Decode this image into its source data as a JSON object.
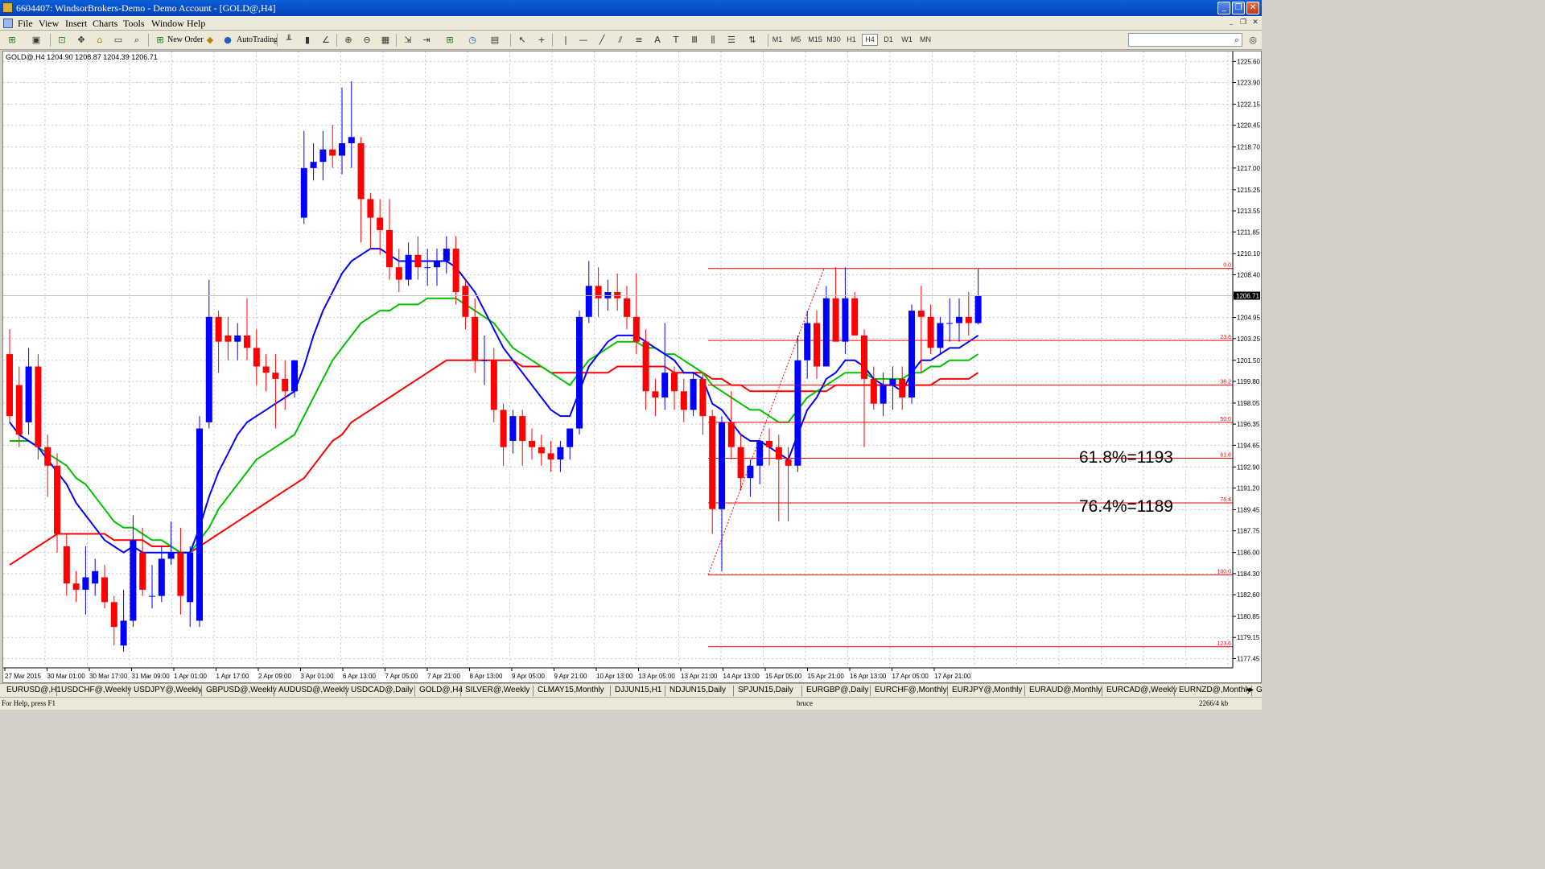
{
  "window": {
    "title": "6604407: WindsorBrokers-Demo - Demo Account - [GOLD@,H4]"
  },
  "menu": [
    "File",
    "View",
    "Insert",
    "Charts",
    "Tools",
    "Window",
    "Help"
  ],
  "toolbar": {
    "new_order": "New Order",
    "autotrading": "AutoTrading",
    "timeframes": [
      "M1",
      "M5",
      "M15",
      "M30",
      "H1",
      "H4",
      "D1",
      "W1",
      "MN"
    ],
    "active_timeframe": "H4"
  },
  "chart_data": {
    "type": "candlestick",
    "symbol_header": "GOLD@,H4  1204.90 1208.87 1204.39 1206.71",
    "current_price": 1206.71,
    "ylim": [
      1176.7,
      1226.4
    ],
    "y_ticks": [
      "1225.60",
      "1223.90",
      "1222.15",
      "1220.45",
      "1218.70",
      "1217.00",
      "1215.25",
      "1213.55",
      "1211.85",
      "1210.10",
      "1208.40",
      "1206.71",
      "1204.95",
      "1203.25",
      "1201.50",
      "1199.80",
      "1198.05",
      "1196.35",
      "1194.65",
      "1192.90",
      "1191.20",
      "1189.45",
      "1187.75",
      "1186.00",
      "1184.30",
      "1182.60",
      "1180.85",
      "1179.15",
      "1177.45"
    ],
    "x_labels": [
      "27 Mar 2015",
      "30 Mar 01:00",
      "30 Mar 17:00",
      "31 Mar 09:00",
      "1 Apr 01:00",
      "1 Apr 17:00",
      "2 Apr 09:00",
      "3 Apr 01:00",
      "6 Apr 13:00",
      "7 Apr 05:00",
      "7 Apr 21:00",
      "8 Apr 13:00",
      "9 Apr 05:00",
      "9 Apr 21:00",
      "10 Apr 13:00",
      "13 Apr 05:00",
      "13 Apr 21:00",
      "14 Apr 13:00",
      "15 Apr 05:00",
      "15 Apr 21:00",
      "16 Apr 13:00",
      "17 Apr 05:00",
      "17 Apr 21:00"
    ],
    "colors": {
      "bull": "#0000ff",
      "bear": "#ff0000",
      "ma_fast": "#0000ff",
      "ma_mid": "#00c000",
      "ma_slow": "#ff0000",
      "fib": "#ff0000"
    },
    "candles": [
      [
        1202.0,
        1204.0,
        1196.5,
        1197.0
      ],
      [
        1199.5,
        1201.0,
        1194.5,
        1195.5
      ],
      [
        1196.5,
        1202.5,
        1195.5,
        1201.0
      ],
      [
        1201.0,
        1202.0,
        1193.5,
        1194.5
      ],
      [
        1194.5,
        1195.5,
        1190.5,
        1193.0
      ],
      [
        1193.0,
        1194.0,
        1186.0,
        1187.5
      ],
      [
        1186.5,
        1187.5,
        1182.5,
        1183.5
      ],
      [
        1183.5,
        1184.5,
        1182.0,
        1183.0
      ],
      [
        1183.0,
        1186.5,
        1181.0,
        1184.0
      ],
      [
        1183.5,
        1185.5,
        1182.5,
        1184.5
      ],
      [
        1184.0,
        1185.0,
        1181.5,
        1182.0
      ],
      [
        1182.0,
        1182.5,
        1178.5,
        1180.0
      ],
      [
        1178.5,
        1183.0,
        1178.0,
        1180.5
      ],
      [
        1180.5,
        1189.0,
        1180.0,
        1187.0
      ],
      [
        1186.0,
        1188.0,
        1182.5,
        1183.0
      ],
      [
        1182.5,
        1185.0,
        1181.5,
        1182.5
      ],
      [
        1182.5,
        1186.5,
        1182.0,
        1185.5
      ],
      [
        1185.5,
        1188.5,
        1185.0,
        1186.0
      ],
      [
        1186.0,
        1188.0,
        1181.0,
        1182.5
      ],
      [
        1182.0,
        1186.5,
        1180.0,
        1186.0
      ],
      [
        1180.5,
        1197.0,
        1180.0,
        1196.0
      ],
      [
        1196.5,
        1208.0,
        1196.0,
        1205.0
      ],
      [
        1205.0,
        1205.5,
        1200.5,
        1203.0
      ],
      [
        1203.5,
        1205.0,
        1201.5,
        1203.0
      ],
      [
        1203.0,
        1204.5,
        1201.5,
        1203.5
      ],
      [
        1203.5,
        1206.5,
        1201.5,
        1202.5
      ],
      [
        1202.5,
        1204.0,
        1199.5,
        1201.0
      ],
      [
        1201.0,
        1202.0,
        1199.0,
        1200.5
      ],
      [
        1200.5,
        1202.0,
        1196.0,
        1200.0
      ],
      [
        1200.0,
        1201.5,
        1197.5,
        1199.0
      ],
      [
        1199.0,
        1201.5,
        1198.5,
        1201.5
      ],
      [
        1213.0,
        1220.0,
        1212.5,
        1217.0
      ],
      [
        1217.0,
        1219.0,
        1216.0,
        1217.5
      ],
      [
        1217.5,
        1220.0,
        1216.0,
        1218.5
      ],
      [
        1218.5,
        1220.5,
        1217.0,
        1218.0
      ],
      [
        1218.0,
        1223.5,
        1216.5,
        1219.0
      ],
      [
        1219.0,
        1224.0,
        1217.0,
        1219.5
      ],
      [
        1219.0,
        1219.5,
        1211.0,
        1214.5
      ],
      [
        1214.5,
        1215.0,
        1210.5,
        1213.0
      ],
      [
        1213.0,
        1214.5,
        1210.0,
        1212.0
      ],
      [
        1212.0,
        1214.5,
        1208.0,
        1209.0
      ],
      [
        1209.0,
        1210.5,
        1207.0,
        1208.0
      ],
      [
        1208.0,
        1211.0,
        1207.5,
        1210.0
      ],
      [
        1210.0,
        1211.5,
        1208.0,
        1209.0
      ],
      [
        1209.0,
        1210.5,
        1207.5,
        1209.0
      ],
      [
        1209.0,
        1210.5,
        1207.5,
        1209.5
      ],
      [
        1209.5,
        1211.5,
        1208.5,
        1210.5
      ],
      [
        1210.5,
        1211.5,
        1206.0,
        1207.0
      ],
      [
        1207.5,
        1208.0,
        1204.0,
        1205.0
      ],
      [
        1205.0,
        1206.5,
        1200.5,
        1201.5
      ],
      [
        1201.5,
        1203.5,
        1199.5,
        1201.5
      ],
      [
        1201.5,
        1202.5,
        1196.5,
        1197.5
      ],
      [
        1197.5,
        1198.0,
        1193.0,
        1194.5
      ],
      [
        1195.0,
        1197.5,
        1194.0,
        1197.0
      ],
      [
        1197.0,
        1197.5,
        1193.0,
        1195.0
      ],
      [
        1195.0,
        1196.0,
        1193.5,
        1194.5
      ],
      [
        1194.5,
        1195.5,
        1193.0,
        1194.0
      ],
      [
        1194.0,
        1195.0,
        1192.5,
        1193.5
      ],
      [
        1193.5,
        1195.0,
        1192.5,
        1194.5
      ],
      [
        1194.5,
        1196.0,
        1193.5,
        1196.0
      ],
      [
        1196.0,
        1205.5,
        1195.5,
        1205.0
      ],
      [
        1205.0,
        1209.5,
        1204.5,
        1207.5
      ],
      [
        1207.5,
        1209.0,
        1205.0,
        1206.5
      ],
      [
        1206.5,
        1208.0,
        1205.5,
        1207.0
      ],
      [
        1207.0,
        1208.5,
        1205.5,
        1206.5
      ],
      [
        1206.5,
        1207.5,
        1204.0,
        1205.0
      ],
      [
        1205.0,
        1208.5,
        1202.0,
        1203.0
      ],
      [
        1203.0,
        1204.0,
        1197.5,
        1199.0
      ],
      [
        1199.0,
        1200.0,
        1197.0,
        1198.5
      ],
      [
        1198.5,
        1204.5,
        1197.5,
        1200.5
      ],
      [
        1200.5,
        1201.0,
        1197.5,
        1199.0
      ],
      [
        1199.0,
        1200.0,
        1196.5,
        1197.5
      ],
      [
        1197.5,
        1200.5,
        1197.0,
        1200.0
      ],
      [
        1200.0,
        1200.5,
        1195.5,
        1197.0
      ],
      [
        1197.0,
        1197.5,
        1187.5,
        1189.5
      ],
      [
        1189.5,
        1197.0,
        1184.5,
        1196.5
      ],
      [
        1196.5,
        1199.0,
        1193.5,
        1194.5
      ],
      [
        1194.5,
        1195.5,
        1191.0,
        1192.0
      ],
      [
        1192.0,
        1193.5,
        1190.5,
        1193.0
      ],
      [
        1193.0,
        1195.0,
        1191.5,
        1195.0
      ],
      [
        1195.0,
        1196.0,
        1193.0,
        1194.5
      ],
      [
        1194.5,
        1195.5,
        1188.5,
        1193.5
      ],
      [
        1193.5,
        1194.5,
        1188.5,
        1193.0
      ],
      [
        1193.0,
        1203.5,
        1192.5,
        1201.5
      ],
      [
        1201.5,
        1205.5,
        1200.0,
        1204.5
      ],
      [
        1204.5,
        1205.5,
        1200.0,
        1201.0
      ],
      [
        1201.0,
        1207.5,
        1201.0,
        1206.5
      ],
      [
        1206.5,
        1209.0,
        1204.5,
        1203.0
      ],
      [
        1203.0,
        1209.0,
        1202.0,
        1206.5
      ],
      [
        1206.5,
        1207.0,
        1203.5,
        1203.5
      ],
      [
        1203.5,
        1204.0,
        1194.5,
        1200.0
      ],
      [
        1200.0,
        1201.0,
        1197.5,
        1198.0
      ],
      [
        1198.0,
        1200.5,
        1197.0,
        1199.5
      ],
      [
        1199.5,
        1201.0,
        1197.5,
        1200.0
      ],
      [
        1200.0,
        1201.0,
        1197.5,
        1198.5
      ],
      [
        1198.5,
        1206.0,
        1198.0,
        1205.5
      ],
      [
        1205.5,
        1207.5,
        1200.5,
        1205.0
      ],
      [
        1205.0,
        1206.0,
        1202.0,
        1202.5
      ],
      [
        1202.5,
        1205.0,
        1202.0,
        1204.5
      ],
      [
        1204.5,
        1206.5,
        1203.0,
        1204.5
      ],
      [
        1204.5,
        1206.5,
        1203.0,
        1205.0
      ],
      [
        1205.0,
        1207.0,
        1203.5,
        1204.5
      ],
      [
        1204.5,
        1208.87,
        1204.39,
        1206.71
      ]
    ],
    "ma_fast": [
      1196.5,
      1195.5,
      1195.0,
      1194.5,
      1193.5,
      1192.5,
      1191.5,
      1190.0,
      1189.0,
      1188.0,
      1187.0,
      1186.5,
      1186.0,
      1186.5,
      1186.0,
      1186.0,
      1186.0,
      1186.0,
      1186.0,
      1186.0,
      1188.0,
      1190.5,
      1192.5,
      1194.0,
      1195.5,
      1196.5,
      1197.0,
      1197.5,
      1198.0,
      1198.5,
      1199.0,
      1201.0,
      1203.5,
      1205.5,
      1207.0,
      1208.5,
      1209.5,
      1210.0,
      1210.5,
      1210.5,
      1210.0,
      1209.5,
      1209.5,
      1209.5,
      1209.5,
      1209.5,
      1209.5,
      1209.0,
      1208.0,
      1207.0,
      1205.5,
      1204.0,
      1202.5,
      1201.5,
      1200.5,
      1199.5,
      1198.5,
      1197.5,
      1197.0,
      1197.0,
      1199.0,
      1201.0,
      1202.0,
      1203.0,
      1203.5,
      1203.5,
      1203.5,
      1203.0,
      1202.5,
      1202.0,
      1201.5,
      1200.5,
      1200.5,
      1200.0,
      1198.0,
      1197.5,
      1196.5,
      1195.5,
      1195.0,
      1195.0,
      1194.5,
      1194.0,
      1193.5,
      1195.5,
      1197.5,
      1198.5,
      1200.0,
      1200.5,
      1201.5,
      1201.5,
      1201.0,
      1200.0,
      1199.5,
      1199.5,
      1199.0,
      1200.5,
      1201.5,
      1201.5,
      1202.0,
      1202.5,
      1202.5,
      1203.0,
      1203.5
    ],
    "ma_mid": [
      1195.0,
      1195.0,
      1195.0,
      1194.5,
      1194.0,
      1193.5,
      1193.0,
      1192.0,
      1191.5,
      1190.5,
      1189.5,
      1188.5,
      1188.0,
      1188.0,
      1187.5,
      1187.0,
      1187.0,
      1186.5,
      1186.0,
      1186.0,
      1187.0,
      1188.0,
      1189.5,
      1190.5,
      1191.5,
      1192.5,
      1193.5,
      1194.0,
      1194.5,
      1195.0,
      1195.5,
      1197.0,
      1198.5,
      1200.0,
      1201.5,
      1202.5,
      1203.5,
      1204.5,
      1205.0,
      1205.5,
      1205.5,
      1206.0,
      1206.0,
      1206.0,
      1206.5,
      1206.5,
      1206.5,
      1206.5,
      1206.0,
      1205.5,
      1205.0,
      1204.5,
      1203.5,
      1202.5,
      1202.0,
      1201.5,
      1201.0,
      1200.5,
      1200.0,
      1199.5,
      1200.5,
      1201.5,
      1202.0,
      1202.5,
      1203.0,
      1203.0,
      1203.0,
      1202.5,
      1202.5,
      1202.0,
      1202.0,
      1201.5,
      1201.0,
      1200.5,
      1199.5,
      1199.0,
      1198.5,
      1198.0,
      1197.5,
      1197.5,
      1197.0,
      1196.5,
      1196.5,
      1197.5,
      1198.5,
      1199.0,
      1199.5,
      1200.0,
      1200.5,
      1200.5,
      1200.5,
      1200.0,
      1200.0,
      1200.0,
      1200.0,
      1200.5,
      1200.5,
      1201.0,
      1201.0,
      1201.5,
      1201.5,
      1201.5,
      1202.0
    ],
    "ma_slow": [
      1185.0,
      1185.5,
      1186.0,
      1186.5,
      1187.0,
      1187.5,
      1187.5,
      1187.5,
      1187.5,
      1187.5,
      1187.5,
      1187.0,
      1187.0,
      1187.0,
      1187.0,
      1186.5,
      1186.5,
      1186.5,
      1186.0,
      1186.0,
      1186.5,
      1187.0,
      1187.5,
      1188.0,
      1188.5,
      1189.0,
      1189.5,
      1190.0,
      1190.5,
      1191.0,
      1191.5,
      1192.0,
      1193.0,
      1194.0,
      1195.0,
      1195.5,
      1196.5,
      1197.0,
      1197.5,
      1198.0,
      1198.5,
      1199.0,
      1199.5,
      1200.0,
      1200.5,
      1201.0,
      1201.5,
      1201.5,
      1201.5,
      1201.5,
      1201.5,
      1201.5,
      1201.5,
      1201.5,
      1201.0,
      1201.0,
      1201.0,
      1200.5,
      1200.5,
      1200.5,
      1200.5,
      1200.5,
      1200.5,
      1200.5,
      1201.0,
      1201.0,
      1201.0,
      1201.0,
      1201.0,
      1201.0,
      1200.5,
      1200.5,
      1200.5,
      1200.5,
      1200.0,
      1200.0,
      1199.5,
      1199.5,
      1199.0,
      1199.0,
      1199.0,
      1199.0,
      1199.0,
      1199.0,
      1199.0,
      1199.0,
      1199.0,
      1199.5,
      1199.5,
      1199.5,
      1199.5,
      1199.5,
      1199.5,
      1199.5,
      1199.5,
      1199.5,
      1199.5,
      1199.5,
      1200.0,
      1200.0,
      1200.0,
      1200.0,
      1200.5
    ],
    "fibonacci": {
      "high": 1208.9,
      "low": 1184.2,
      "levels": [
        {
          "label": "0.0",
          "price": 1208.9
        },
        {
          "label": "23.6",
          "price": 1203.1
        },
        {
          "label": "38.2",
          "price": 1199.5
        },
        {
          "label": "50.0",
          "price": 1196.5
        },
        {
          "label": "61.8",
          "price": 1193.6
        },
        {
          "label": "76.4",
          "price": 1190.0
        },
        {
          "label": "100.0",
          "price": 1184.2
        },
        {
          "label": "123.6",
          "price": 1178.4
        }
      ],
      "annotations": [
        "61.8%=1193",
        "76.4%=1189"
      ]
    }
  },
  "symbol_tabs": [
    "EURUSD@,H1",
    "USDCHF@,Weekly",
    "USDJPY@,Weekly",
    "GBPUSD@,Weekly",
    "AUDUSD@,Weekly",
    "USDCAD@,Daily",
    "GOLD@,H4",
    "SILVER@,Weekly",
    "CLMAY15,Monthly",
    "DJJUN15,H1",
    "NDJUN15,Daily",
    "SPJUN15,Daily",
    "EURGBP@,Daily",
    "EURCHF@,Monthly",
    "EURJPY@,Monthly",
    "EURAUD@,Monthly",
    "EURCAD@,Weekly",
    "EURNZD@,Monthly",
    "G"
  ],
  "status": {
    "help": "For Help, press F1",
    "profile": "bruce",
    "traffic": "2266/4 kb"
  }
}
